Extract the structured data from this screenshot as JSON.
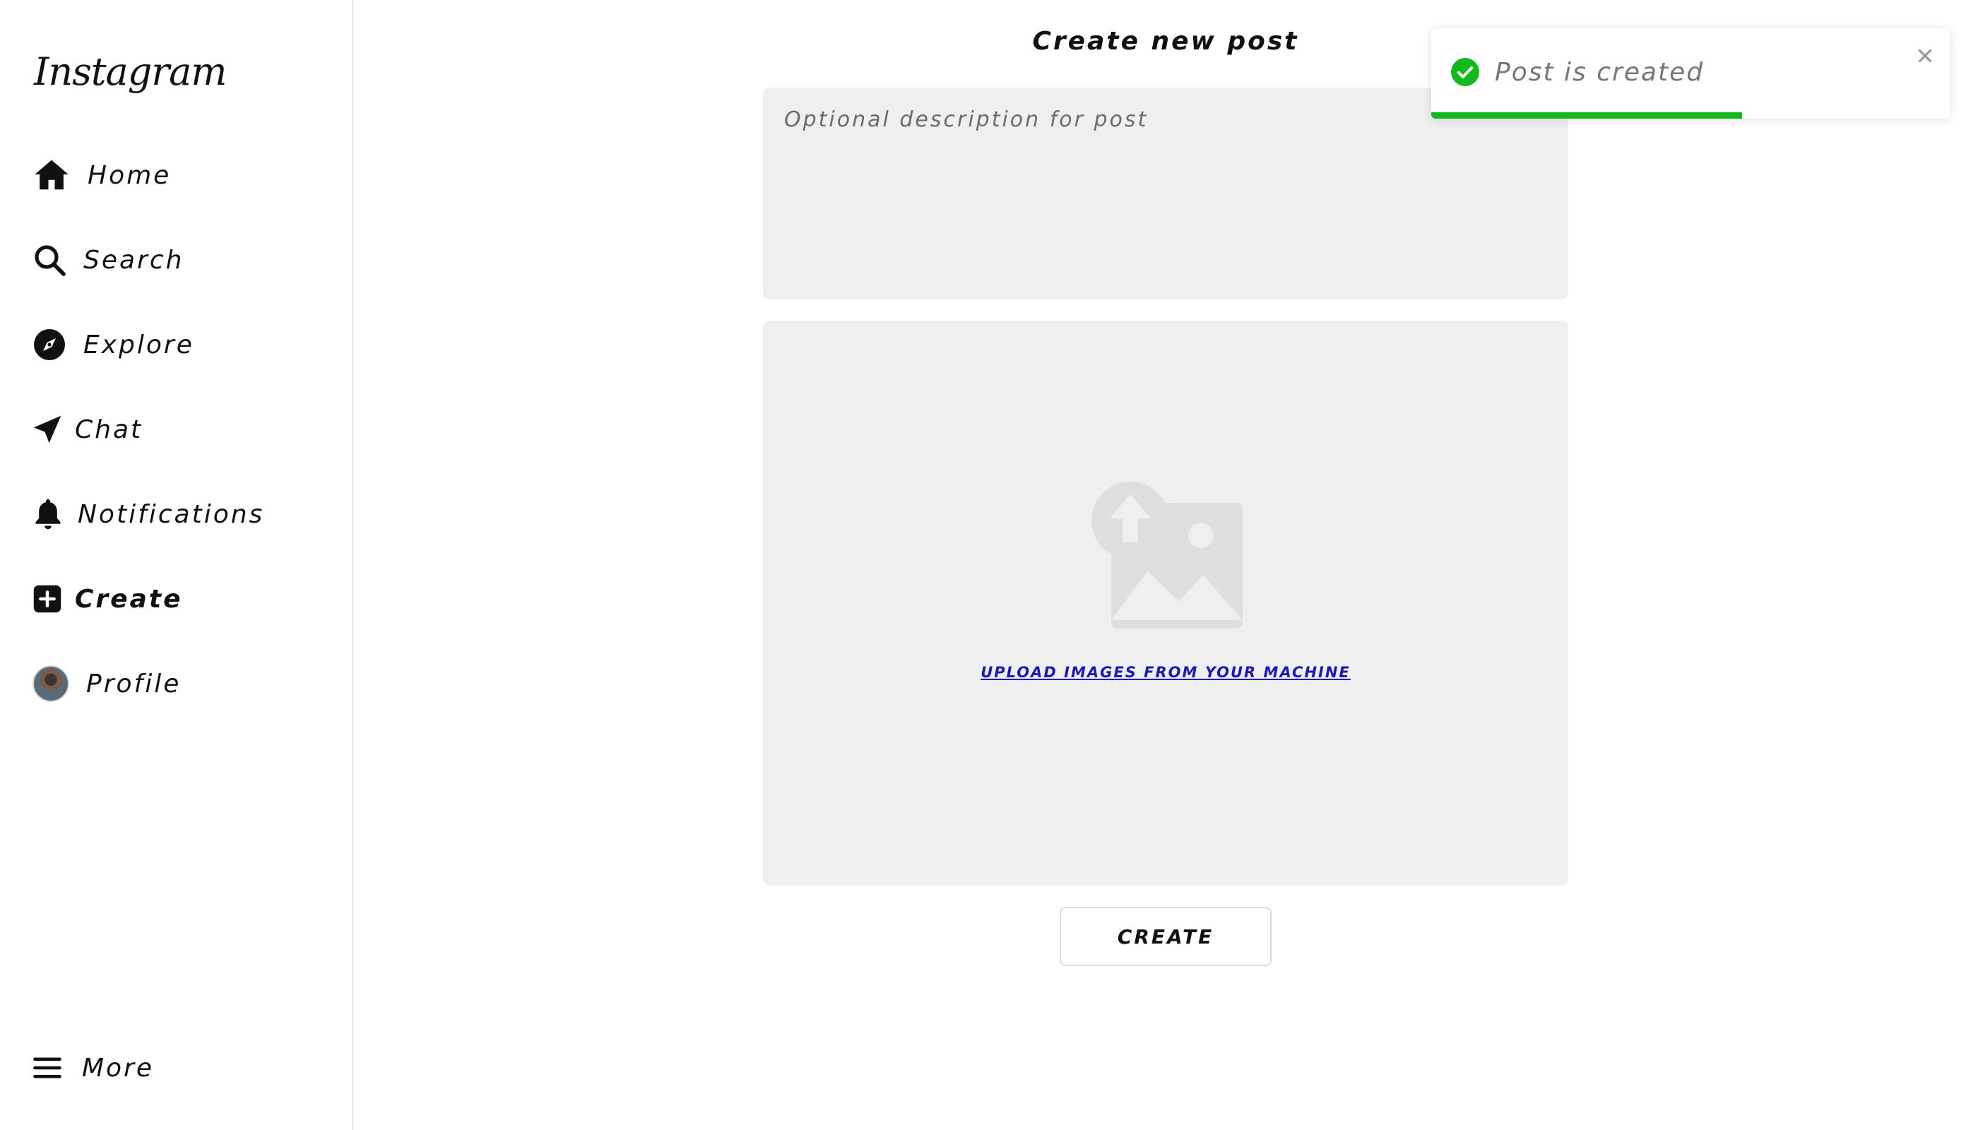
{
  "sidebar": {
    "logo": "Instagram",
    "items": [
      {
        "label": "Home",
        "icon": "home-icon"
      },
      {
        "label": "Search",
        "icon": "search-icon"
      },
      {
        "label": "Explore",
        "icon": "compass-icon"
      },
      {
        "label": "Chat",
        "icon": "send-icon"
      },
      {
        "label": "Notifications",
        "icon": "bell-icon"
      },
      {
        "label": "Create",
        "icon": "plus-square-icon",
        "active": true
      },
      {
        "label": "Profile",
        "icon": "avatar"
      }
    ],
    "more": {
      "label": "More",
      "icon": "menu-icon"
    }
  },
  "main": {
    "title": "Create new post",
    "description_placeholder": "Optional description for post",
    "description_value": "",
    "upload_link": "UPLOAD IMAGES FROM YOUR MACHINE",
    "create_button": "CREATE"
  },
  "toast": {
    "message": "Post is created",
    "status": "success",
    "progress": 0.6,
    "accent_color": "#12b81c"
  },
  "colors": {
    "panel_bg": "#efefef",
    "link": "#1a1ab8"
  }
}
